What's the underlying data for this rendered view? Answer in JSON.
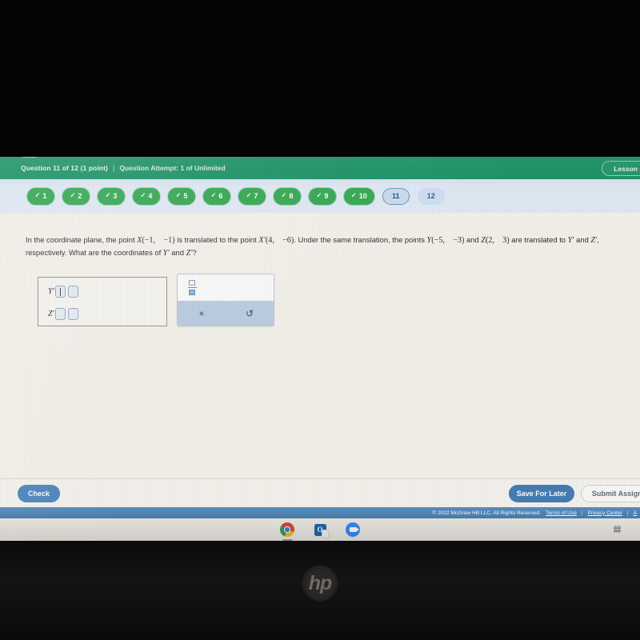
{
  "device": {
    "brand_logo": "hp",
    "bezel_color": "#0b0b0c"
  },
  "header": {
    "question_progress": "Question 11 of 12 (1 point)",
    "separator": "|",
    "attempt": "Question Attempt: 1 of Unlimited",
    "lesson_button": "Lesson",
    "menu_icon": "hamburger-menu-icon",
    "background_color": "#16a069"
  },
  "pill_nav": {
    "background_color": "#dfeaf7",
    "done_color": "#2eaa4e",
    "current_color": "#c9dcf3",
    "check_glyph": "✓",
    "pills": [
      {
        "label": "1",
        "state": "done"
      },
      {
        "label": "2",
        "state": "done"
      },
      {
        "label": "3",
        "state": "done"
      },
      {
        "label": "4",
        "state": "done"
      },
      {
        "label": "5",
        "state": "done"
      },
      {
        "label": "6",
        "state": "done"
      },
      {
        "label": "7",
        "state": "done"
      },
      {
        "label": "8",
        "state": "done"
      },
      {
        "label": "9",
        "state": "done"
      },
      {
        "label": "10",
        "state": "done"
      },
      {
        "label": "11",
        "state": "current"
      },
      {
        "label": "12",
        "state": "upcoming"
      }
    ]
  },
  "question": {
    "part1": "In the coordinate plane, the point ",
    "pointX": "X",
    "pointX_coords": "(−1, −1)",
    "part2": " is translated to the point ",
    "pointXp": "X′",
    "pointXp_coords": "(4, −6)",
    "part3": ". Under the same translation, the points ",
    "pointY": "Y",
    "pointY_coords": "(−5, −3)",
    "part4": " and ",
    "pointZ": "Z",
    "pointZ_coords": "(2, 3)",
    "part5": " are translated to ",
    "pointYp": "Y′",
    "part6": " and ",
    "pointZp": "Z′",
    "part7": ", respectively. What are the coordinates of ",
    "pointYp2": "Y′",
    "part8": " and ",
    "pointZp2": "Z′",
    "part9": "?"
  },
  "answer": {
    "row1_label": "Y′",
    "row2_label": "Z′",
    "row1_value_x": "",
    "row1_value_y": "",
    "row2_value_x": "",
    "row2_value_y": "",
    "input_border_color": "#8fa7c6",
    "box_border_color": "#9a9483"
  },
  "tool_palette": {
    "fraction_icon": "fraction-template-icon",
    "clear_glyph": "×",
    "undo_glyph": "↺",
    "clear_name": "clear-button",
    "undo_name": "undo-button",
    "bar_color": "#b9cce4"
  },
  "footer": {
    "check_label": "Check",
    "save_label": "Save For Later",
    "submit_label": "Submit Assignment",
    "check_color": "#4a87c4",
    "save_color": "#3f7cba"
  },
  "copyright": {
    "text": "© 2022 McGraw Hill LLC. All Rights Reserved.",
    "terms": "Terms of Use",
    "privacy": "Privacy Center",
    "accessibility": "A",
    "divider": "|",
    "bar_color": "#437fb5"
  },
  "taskbar": {
    "background_color": "#efece4",
    "icons": [
      {
        "name": "chrome-icon",
        "label": "Google Chrome"
      },
      {
        "name": "outlook-icon",
        "label": "Outlook",
        "glyph": "O"
      },
      {
        "name": "zoom-icon",
        "label": "Zoom"
      }
    ],
    "tray_glyph": "▤",
    "tray_name": "notification-tray-icon"
  }
}
